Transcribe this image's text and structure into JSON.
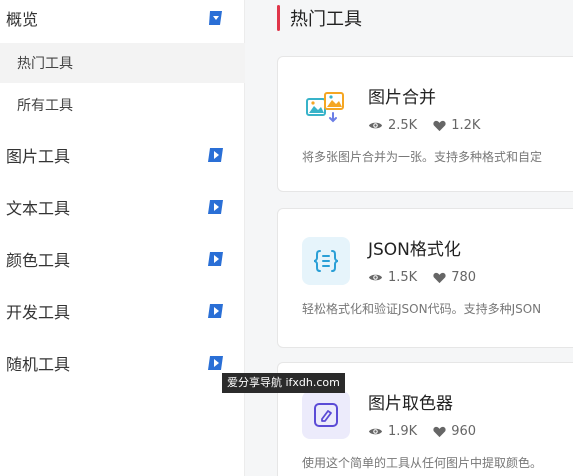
{
  "sidebar": {
    "groups": [
      {
        "label": "概览",
        "sub": [
          {
            "label": "热门工具"
          },
          {
            "label": "所有工具"
          }
        ]
      },
      {
        "label": "图片工具"
      },
      {
        "label": "文本工具"
      },
      {
        "label": "颜色工具"
      },
      {
        "label": "开发工具"
      },
      {
        "label": "随机工具"
      }
    ],
    "accent_color": "#2a6fd6"
  },
  "main": {
    "section_title": "热门工具",
    "accent_color": "#e0364a",
    "cards": [
      {
        "title": "图片合并",
        "views": "2.5K",
        "likes": "1.2K",
        "desc": "将多张图片合并为一张。支持多种格式和自定",
        "icon": "image-merge-icon"
      },
      {
        "title": "JSON格式化",
        "views": "1.5K",
        "likes": "780",
        "desc": "轻松格式化和验证JSON代码。支持多种JSON",
        "icon": "json-braces-icon"
      },
      {
        "title": "图片取色器",
        "views": "1.9K",
        "likes": "960",
        "desc": "使用这个简单的工具从任何图片中提取颜色。",
        "icon": "color-picker-icon"
      }
    ]
  },
  "watermark": "爱分享导航 ifxdh.com"
}
